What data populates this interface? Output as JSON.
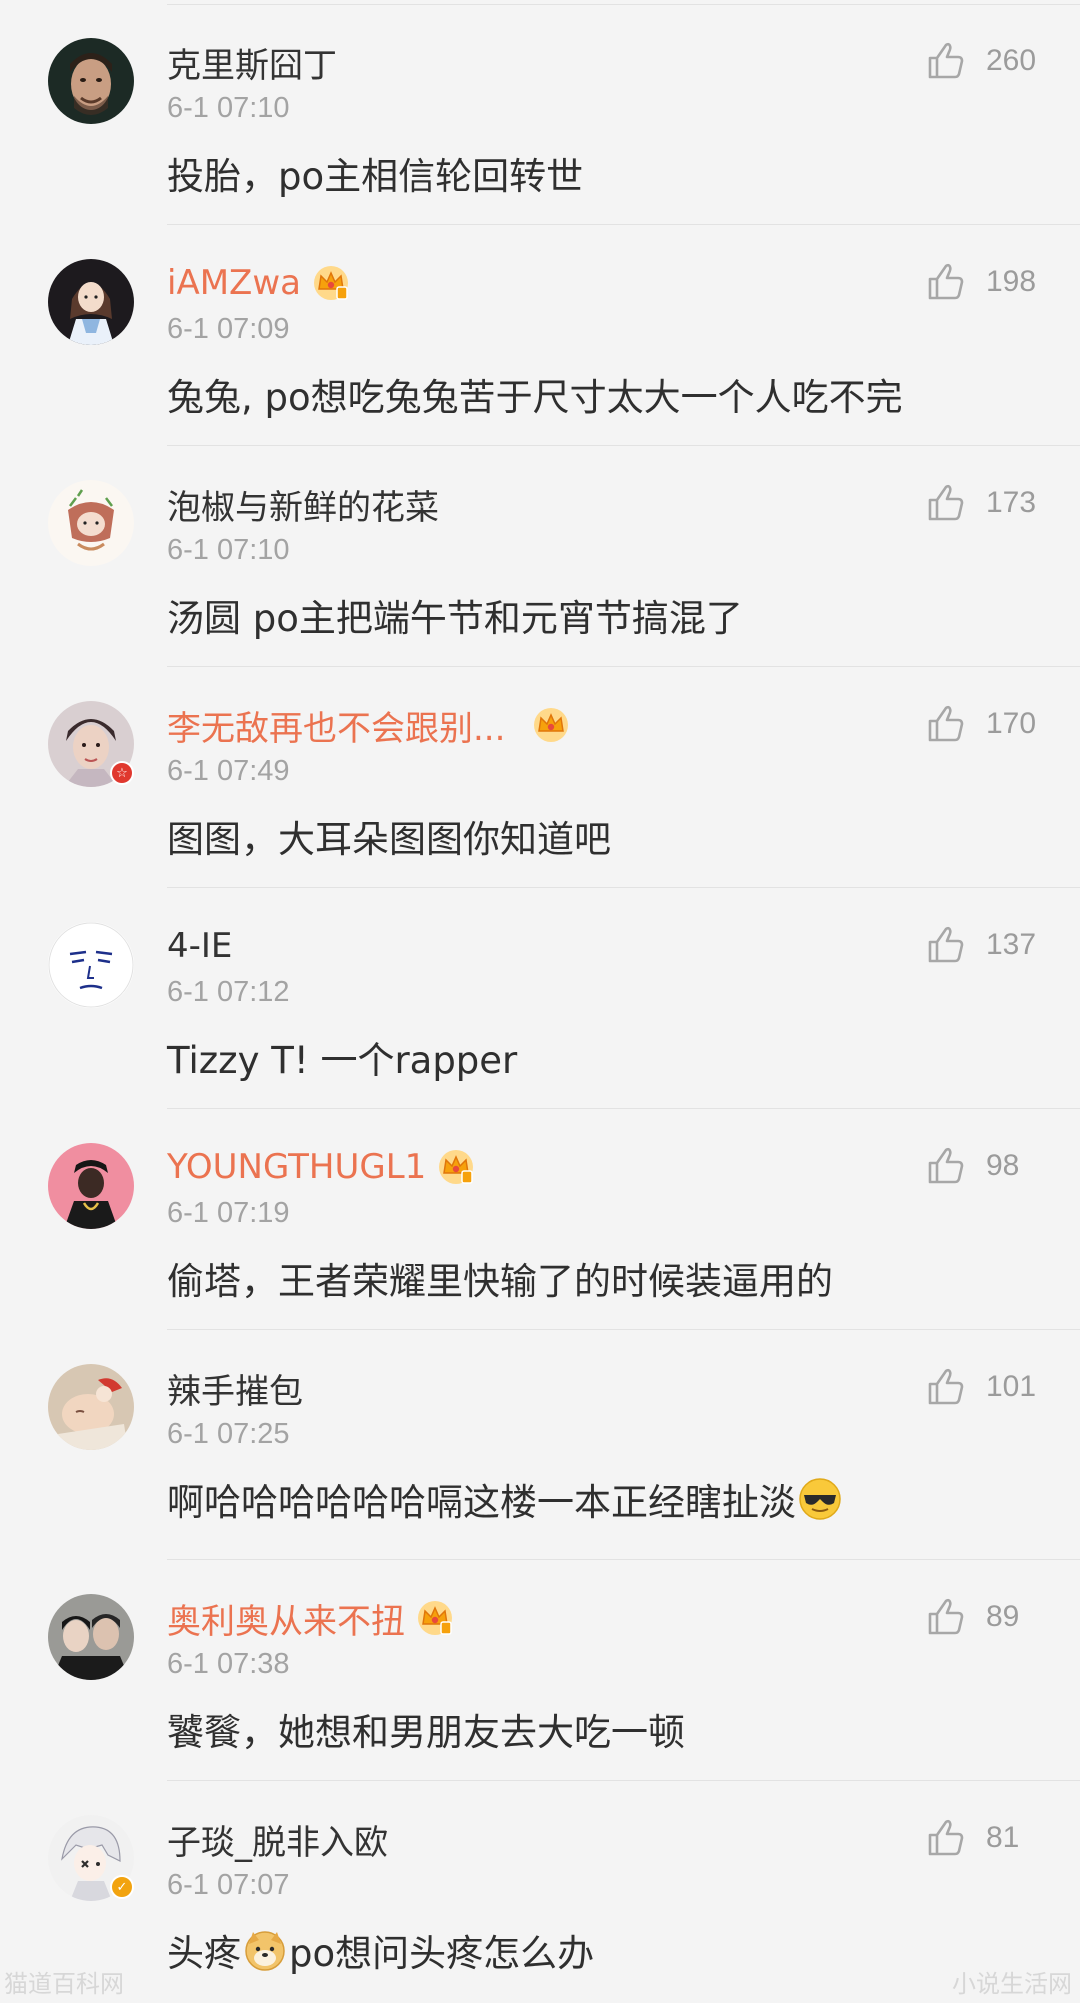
{
  "comments": [
    {
      "username": "克里斯囧丁",
      "vip": false,
      "timestamp": "6-1 07:10",
      "likes": "260",
      "text": "投胎，po主相信轮回转世",
      "avatar": "man-portrait-avatar",
      "badge": ""
    },
    {
      "username": "iAMZwa",
      "vip": true,
      "timestamp": "6-1 07:09",
      "likes": "198",
      "text": "兔兔, po想吃兔兔苦于尺寸太大一个人吃不完",
      "avatar": "cartoon-girl-avatar",
      "badge": ""
    },
    {
      "username": "泡椒与新鲜的花菜",
      "vip": false,
      "timestamp": "6-1 07:10",
      "likes": "173",
      "text": "汤圆 po主把端午节和元宵节搞混了",
      "avatar": "anime-doodle-avatar",
      "badge": ""
    },
    {
      "username": "李无敌再也不会跟别...",
      "vip": true,
      "timestamp": "6-1 07:49",
      "likes": "170",
      "text": "图图，大耳朵图图你知道吧",
      "avatar": "young-man-avatar",
      "badge": "red"
    },
    {
      "username": "4-IE",
      "vip": false,
      "timestamp": "6-1 07:12",
      "likes": "137",
      "text": "Tizzy T! 一个rapper",
      "avatar": "sketch-face-avatar",
      "badge": ""
    },
    {
      "username": "YOUNGTHUGL1",
      "vip": true,
      "timestamp": "6-1 07:19",
      "likes": "98",
      "text": "偷塔，王者荣耀里快输了的时候装逼用的",
      "avatar": "rapper-pink-avatar",
      "badge": ""
    },
    {
      "username": "辣手摧包",
      "vip": false,
      "timestamp": "6-1 07:25",
      "likes": "101",
      "text_parts": [
        "啊哈哈哈哈哈哈嗝这楼一本正经瞎扯淡"
      ],
      "text": "啊哈哈哈哈哈哈嗝这楼一本正经瞎扯淡",
      "emoji_after": "sunglasses-emoji",
      "avatar": "sleeping-baby-avatar",
      "badge": ""
    },
    {
      "username": "奥利奥从来不扭",
      "vip": true,
      "timestamp": "6-1 07:38",
      "likes": "89",
      "text": "饕餮，她想和男朋友去大吃一顿",
      "avatar": "couple-photo-avatar",
      "badge": ""
    },
    {
      "username": "子琰_脱非入欧",
      "vip": false,
      "timestamp": "6-1 07:07",
      "likes": "81",
      "text_before": "头疼",
      "text_after": "po想问头疼怎么办",
      "emoji_mid": "doge-emoji",
      "avatar": "anime-white-hair-avatar",
      "badge": "gold"
    }
  ],
  "badges": {
    "red": "☆",
    "gold": "✓"
  },
  "colors": {
    "background": "#f4f4f4",
    "vip_name": "#eb7350",
    "name": "#333333",
    "meta": "#a3a3a3",
    "like": "#9b9b9b"
  },
  "watermark": {
    "left": "猫道百科网",
    "right": "小说生活网"
  }
}
